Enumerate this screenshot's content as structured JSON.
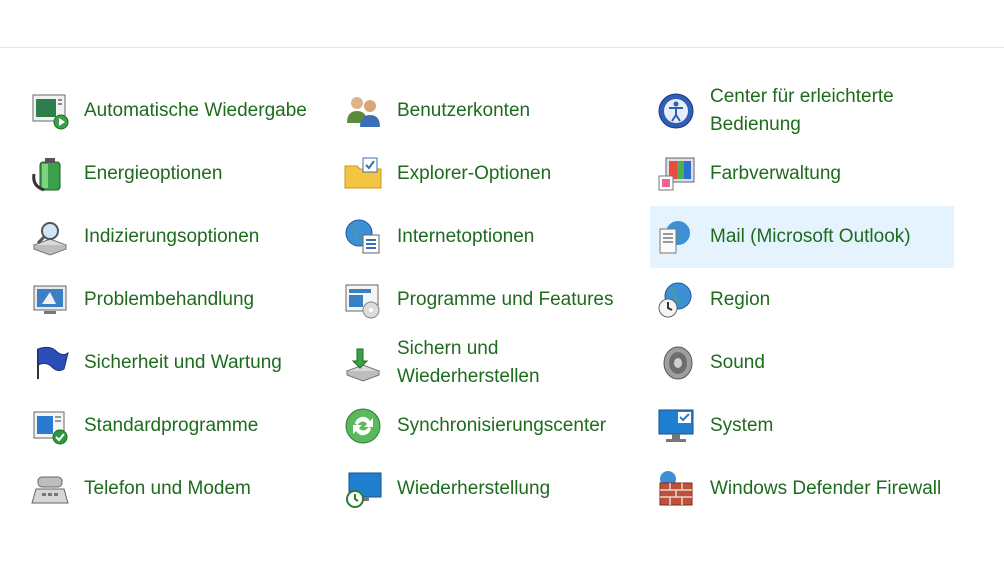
{
  "columns": [
    {
      "items": [
        {
          "label": "Automatische Wiedergabe",
          "icon": "autoplay-icon"
        },
        {
          "label": "Energieoptionen",
          "icon": "power-options-icon"
        },
        {
          "label": "Indizierungsoptionen",
          "icon": "indexing-icon"
        },
        {
          "label": "Problembehandlung",
          "icon": "troubleshooting-icon"
        },
        {
          "label": "Sicherheit und Wartung",
          "icon": "flag-icon"
        },
        {
          "label": "Standardprogramme",
          "icon": "default-programs-icon"
        },
        {
          "label": "Telefon und Modem",
          "icon": "phone-modem-icon"
        }
      ]
    },
    {
      "items": [
        {
          "label": "Benutzerkonten",
          "icon": "user-accounts-icon"
        },
        {
          "label": "Explorer-Optionen",
          "icon": "folder-options-icon"
        },
        {
          "label": "Internetoptionen",
          "icon": "internet-options-icon"
        },
        {
          "label": "Programme und Features",
          "icon": "programs-features-icon"
        },
        {
          "label": "Sichern und Wiederherstellen",
          "icon": "backup-restore-icon"
        },
        {
          "label": "Synchronisierungscenter",
          "icon": "sync-center-icon"
        },
        {
          "label": "Wiederherstellung",
          "icon": "recovery-icon"
        }
      ]
    },
    {
      "items": [
        {
          "label": "Center für erleichterte Bedienung",
          "icon": "ease-of-access-icon"
        },
        {
          "label": "Farbverwaltung",
          "icon": "color-management-icon"
        },
        {
          "label": "Mail (Microsoft Outlook)",
          "icon": "mail-icon"
        },
        {
          "label": "Region",
          "icon": "region-icon"
        },
        {
          "label": "Sound",
          "icon": "speaker-icon"
        },
        {
          "label": "System",
          "icon": "system-monitor-icon"
        },
        {
          "label": "Windows Defender Firewall",
          "icon": "firewall-icon"
        }
      ]
    }
  ],
  "colors": {
    "link": "#1e6b1e",
    "hover_bg": "#e5f3ff",
    "accent": "#0078d7"
  }
}
